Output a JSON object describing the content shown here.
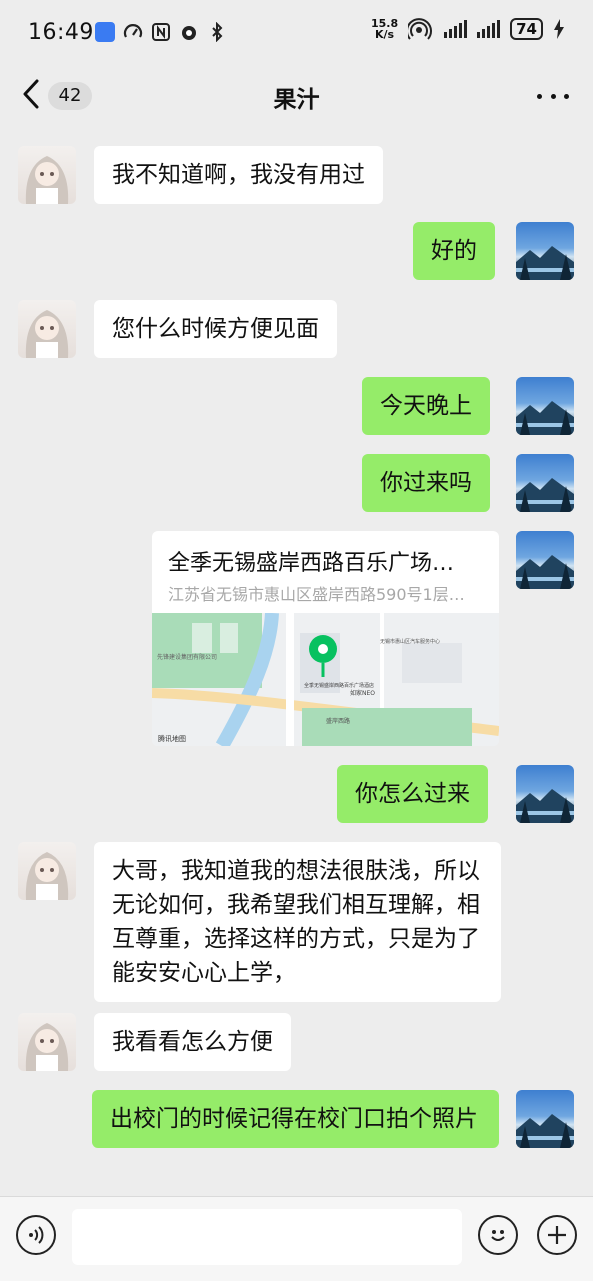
{
  "status_bar": {
    "time": "16:49",
    "net_speed_top": "15.8",
    "net_speed_bottom": "K/s",
    "battery": "74"
  },
  "header": {
    "unread_count": "42",
    "title": "果汁"
  },
  "messages": [
    {
      "side": "in",
      "text": "我不知道啊，我没有用过"
    },
    {
      "side": "out",
      "text": "好的"
    },
    {
      "side": "in",
      "text": "您什么时候方便见面"
    },
    {
      "side": "out",
      "text": "今天晚上"
    },
    {
      "side": "out",
      "text": "你过来吗"
    },
    {
      "side": "out",
      "type": "location",
      "title": "全季无锡盛岸西路百乐广场…",
      "address": "江苏省无锡市惠山区盛岸西路590号1层…",
      "map_source": "腾讯地图"
    },
    {
      "side": "out",
      "text": "你怎么过来"
    },
    {
      "side": "in",
      "text": "大哥，我知道我的想法很肤浅，所以无论如何，我希望我们相互理解，相互尊重，选择这样的方式，只是为了能安安心心上学，"
    },
    {
      "side": "in",
      "text": "我看看怎么方便"
    },
    {
      "side": "out",
      "text": "出校门的时候记得在校门口拍个照片"
    }
  ],
  "map_labels": {
    "road": "盛岸西路",
    "poi_1": "全季无锡盛岸西路百乐广场酒店",
    "poi_2": "如家NEO",
    "poi_3": "无锡市惠山区汽车服务中心",
    "poi_4": "先锋建设集团有限公司"
  },
  "colors": {
    "background": "#ededed",
    "outgoing_bubble": "#95ec69",
    "incoming_bubble": "#ffffff",
    "pin": "#07c160"
  },
  "icons": [
    "back-chevron-icon",
    "more-dots-icon",
    "voice-icon",
    "emoji-icon",
    "plus-icon",
    "location-pin-icon"
  ]
}
